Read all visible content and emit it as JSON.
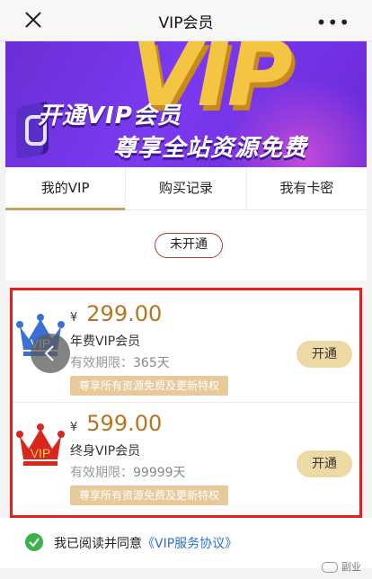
{
  "header": {
    "title": "VIP会员",
    "more": "•••"
  },
  "banner": {
    "big_text": "VIP",
    "line1": "开通VIP会员",
    "line2": "尊享全站资源免费"
  },
  "tabs": [
    {
      "label": "我的VIP",
      "active": true
    },
    {
      "label": "购买记录",
      "active": false
    },
    {
      "label": "我有卡密",
      "active": false
    }
  ],
  "status": {
    "label": "未开通"
  },
  "plans": [
    {
      "currency": "¥",
      "price": "299.00",
      "name": "年费VIP会员",
      "validity_label": "有效期限：",
      "validity_value": "365天",
      "badge": "尊享所有资源免费及更新特权",
      "button": "开通",
      "crown_color": "#3b6fd8",
      "crown_text": "VIP"
    },
    {
      "currency": "¥",
      "price": "599.00",
      "name": "终身VIP会员",
      "validity_label": "有效期限：",
      "validity_value": "99999天",
      "badge": "尊享所有资源免费及更新特权",
      "button": "开通",
      "crown_color": "#d9271e",
      "crown_text": "VIP"
    }
  ],
  "agreement": {
    "text": "我已阅读并同意",
    "link": "《VIP服务协议》",
    "checked": true
  },
  "watermark": "副业",
  "colors": {
    "accent_gold": "#c9a25e",
    "price": "#b8751f",
    "highlight_border": "#e31f1f",
    "banner": "#7b3af0"
  }
}
